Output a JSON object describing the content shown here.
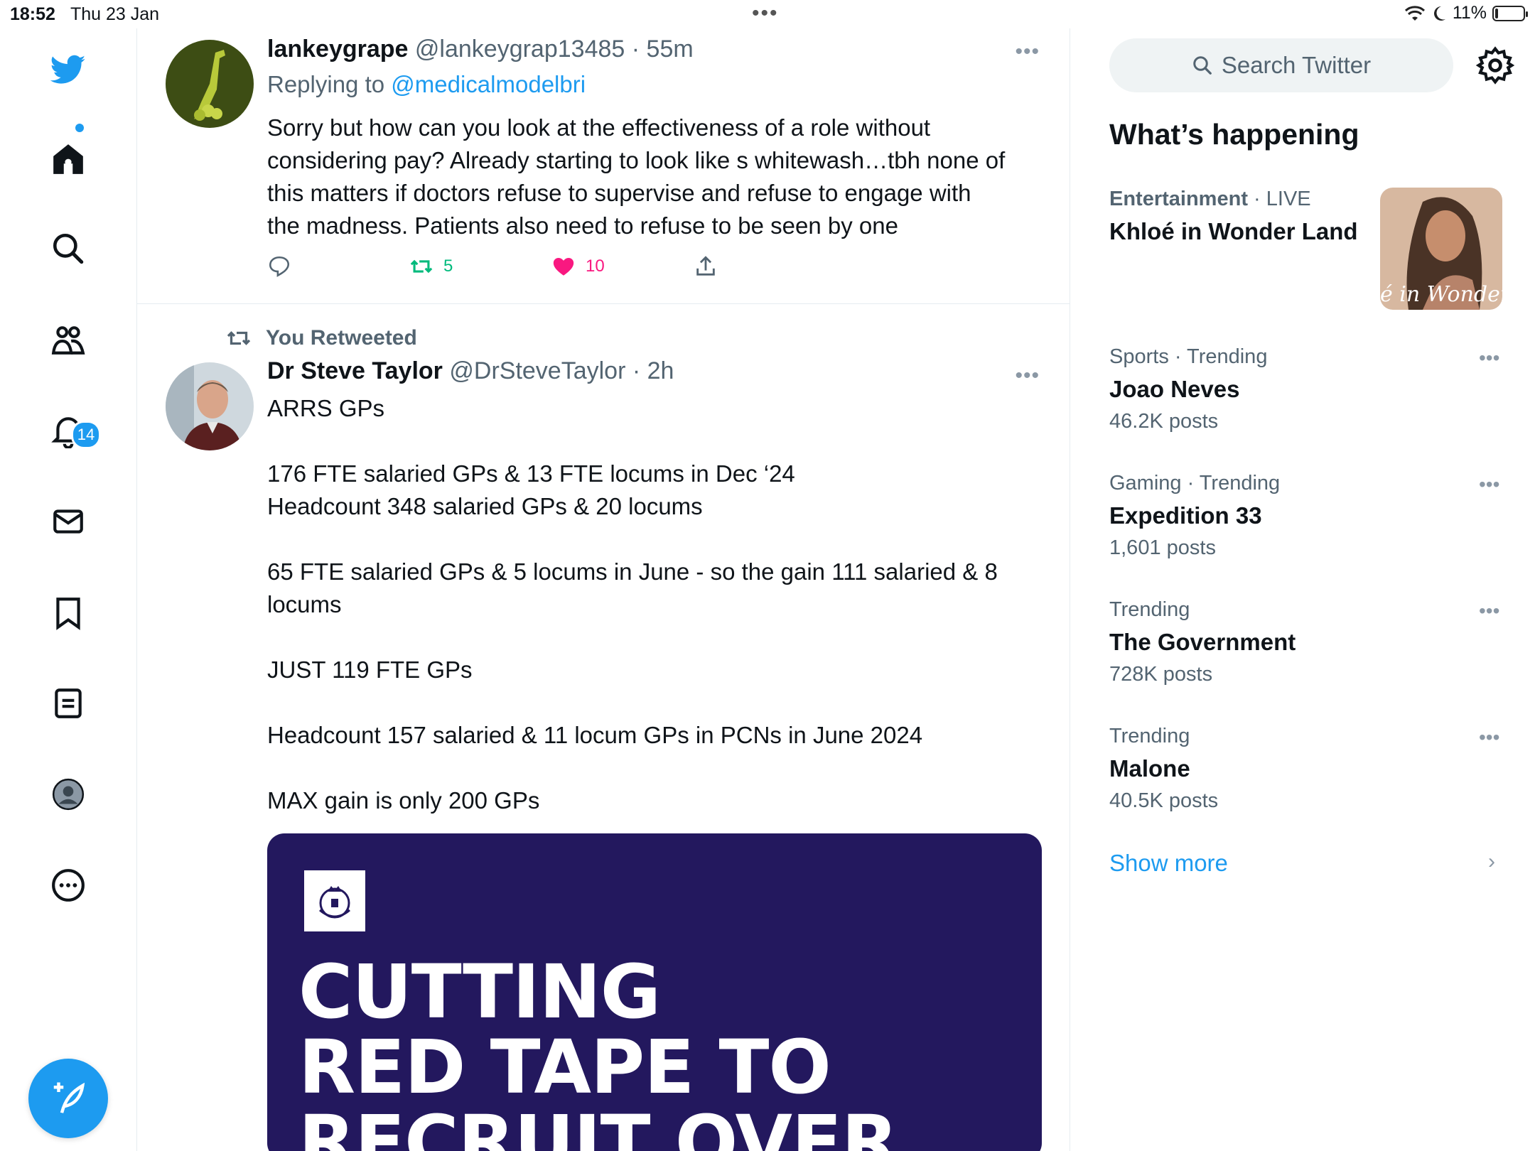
{
  "status_bar": {
    "time": "18:52",
    "date": "Thu 23 Jan",
    "battery_percent": "11%",
    "battery_level": 0.11
  },
  "nav": {
    "notifications_badge": "14",
    "items": [
      "home-icon",
      "search-icon",
      "communities-icon",
      "notifications-icon",
      "messages-icon",
      "bookmarks-icon",
      "lists-icon",
      "profile-icon",
      "more-icon"
    ]
  },
  "tweets": [
    {
      "name": "lankeygrape",
      "handle": "@lankeygrap13485",
      "time": "55m",
      "replying_label": "Replying to",
      "replying_to": "@medicalmodelbri",
      "text": "Sorry but how can you look at the effectiveness of a role without\nconsidering pay? Already starting to look like s whitewash…tbh none of\nthis matters if doctors refuse to supervise and refuse to engage with\nthe madness. Patients also need to refuse to be seen by one",
      "retweets": "5",
      "likes": "10"
    },
    {
      "retweet_label": "You Retweeted",
      "name": "Dr Steve Taylor",
      "handle": "@DrSteveTaylor",
      "time": "2h",
      "text": "ARRS GPs\n\n176 FTE salaried GPs & 13 FTE locums in Dec ‘24\nHeadcount 348 salaried GPs & 20 locums\n\n65 FTE salaried GPs & 5 locums in June - so the gain 111 salaried & 8\nlocums\n\nJUST 119 FTE GPs\n\nHeadcount 157 salaried & 11 locum GPs in PCNs in June 2024\n\nMAX gain is only 200 GPs",
      "media_headline": "CUTTING\nRED TAPE TO\nRECRUIT OVER"
    }
  ],
  "sidebar": {
    "search_placeholder": "Search Twitter",
    "section_title": "What’s happening",
    "trends": [
      {
        "category": "Entertainment",
        "sep": " · ",
        "status": "LIVE",
        "topic": "Khloé in Wonder Land",
        "count": ""
      },
      {
        "category": "Sports · Trending",
        "sep": "",
        "status": "",
        "topic": "Joao Neves",
        "count": "46.2K posts"
      },
      {
        "category": "Gaming · Trending",
        "sep": "",
        "status": "",
        "topic": "Expedition 33",
        "count": "1,601 posts"
      },
      {
        "category": "Trending",
        "sep": "",
        "status": "",
        "topic": "The Government",
        "count": "728K posts"
      },
      {
        "category": "Trending",
        "sep": "",
        "status": "",
        "topic": "Malone",
        "count": "40.5K posts"
      }
    ],
    "trend_image_caption": "é in Wonder L",
    "show_more": "Show more"
  },
  "colors": {
    "accent": "#1d9bf0",
    "retweet_green": "#00ba7c",
    "like_pink": "#f91880",
    "media_bg": "#23185e"
  }
}
